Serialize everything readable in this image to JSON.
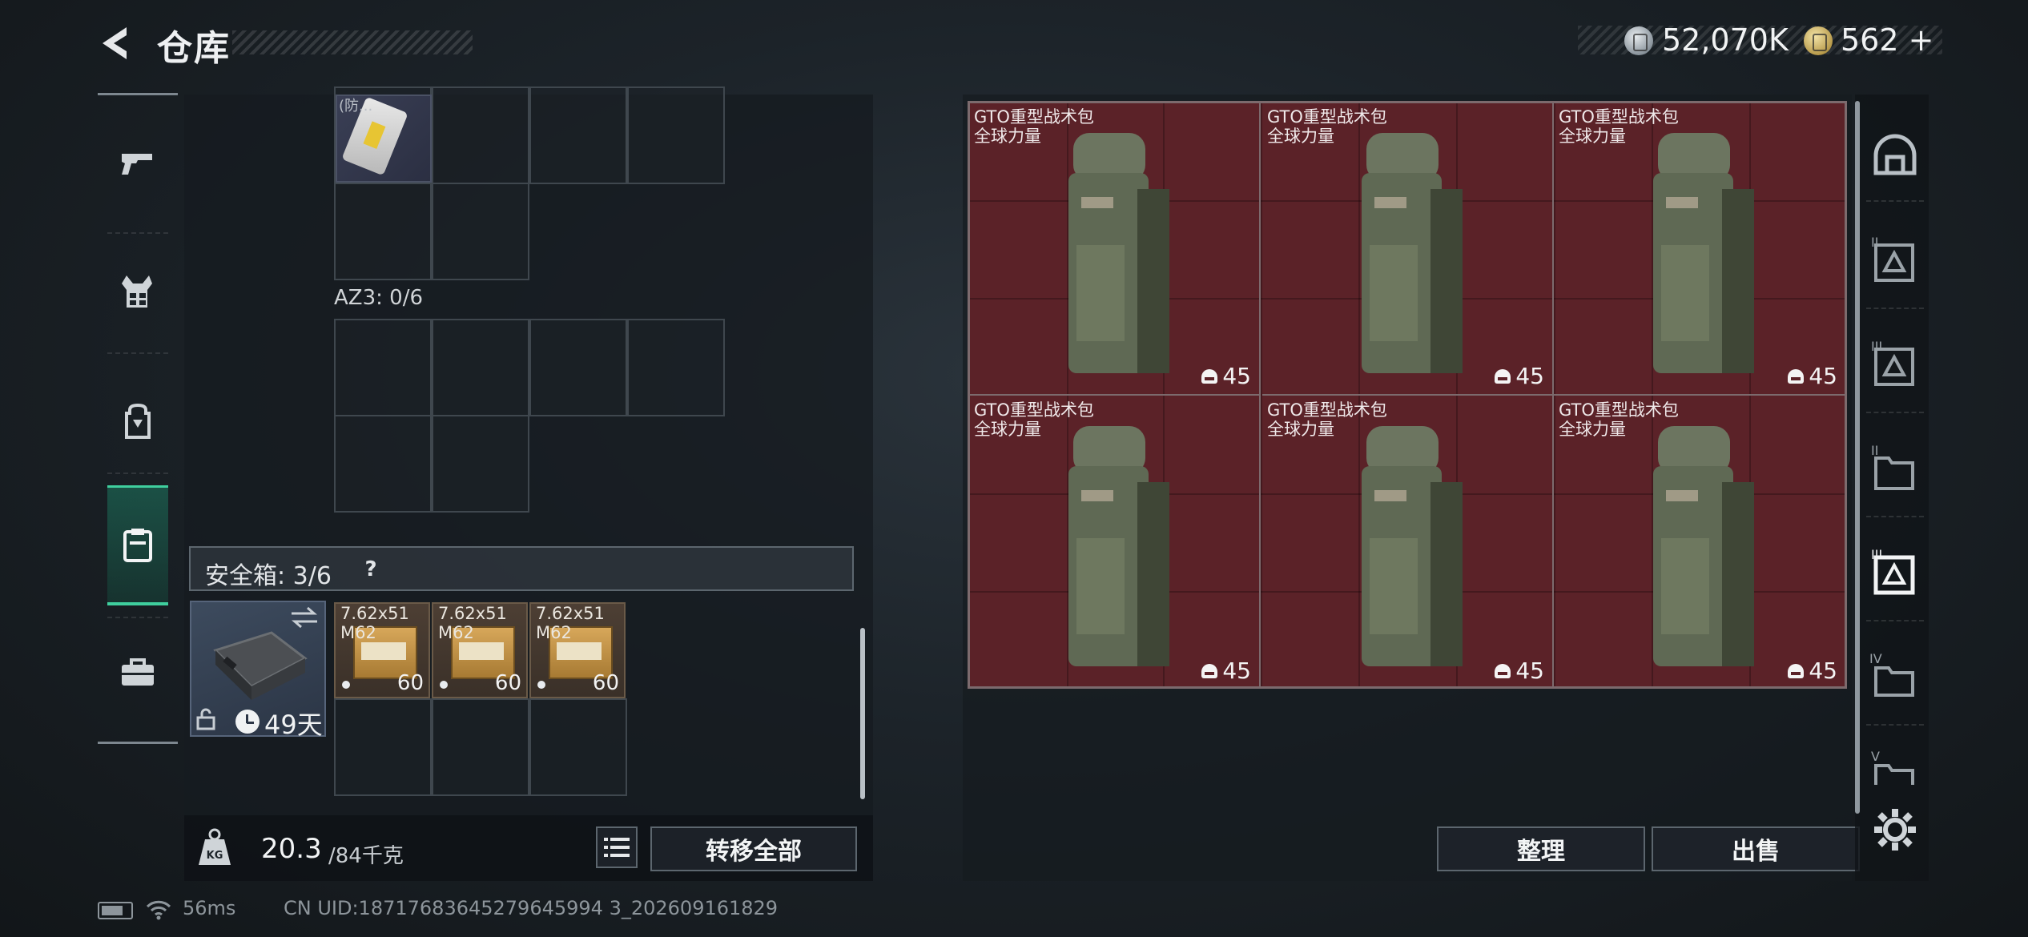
{
  "header": {
    "title": "仓库",
    "currency_silver": "52,070K",
    "currency_gold": "562",
    "currency_gold_suffix": "+"
  },
  "left_sidebar": {
    "items": [
      {
        "icon": "pistol-icon"
      },
      {
        "icon": "vest-icon"
      },
      {
        "icon": "backpack-icon"
      },
      {
        "icon": "container-icon",
        "active": true
      },
      {
        "icon": "briefcase-icon"
      }
    ]
  },
  "inventory": {
    "top_item_label": "(防...",
    "az3_label": "AZ3: 0/6",
    "safe_box_label": "安全箱: 3/6",
    "help_label": "?",
    "case_days": "49天",
    "ammo": [
      {
        "name_line1": "7.62x51",
        "name_line2": "M62",
        "count": "60"
      },
      {
        "name_line1": "7.62x51",
        "name_line2": "M62",
        "count": "60"
      },
      {
        "name_line1": "7.62x51",
        "name_line2": "M62",
        "count": "60"
      }
    ],
    "weight_value": "20.3",
    "weight_max": "/84千克",
    "transfer_all_label": "转移全部"
  },
  "stash": {
    "items": [
      {
        "name": "GTO重型战术包",
        "subtitle": "全球力量",
        "tag": "45"
      },
      {
        "name": "GTO重型战术包",
        "subtitle": "全球力量",
        "tag": "45"
      },
      {
        "name": "GTO重型战术包",
        "subtitle": "全球力量",
        "tag": "45"
      },
      {
        "name": "GTO重型战术包",
        "subtitle": "全球力量",
        "tag": "45"
      },
      {
        "name": "GTO重型战术包",
        "subtitle": "全球力量",
        "tag": "45"
      },
      {
        "name": "GTO重型战术包",
        "subtitle": "全球力量",
        "tag": "45"
      }
    ],
    "sort_label": "整理",
    "sell_label": "出售"
  },
  "right_sidebar": {
    "tabs": [
      {
        "icon": "home-stash-icon"
      },
      {
        "icon": "tier-ii-stash-icon",
        "label": "II"
      },
      {
        "icon": "tier-iii-stash-icon",
        "label": "III"
      },
      {
        "icon": "tier-ii-folder-icon",
        "label": "II"
      },
      {
        "icon": "tier-iii-active-icon",
        "label": "III"
      },
      {
        "icon": "tier-iv-icon",
        "label": "IV"
      },
      {
        "icon": "tier-v-icon",
        "label": "V"
      }
    ]
  },
  "footer": {
    "ping": "56ms",
    "uid": "CN UID:18717683645279645994 3_202609161829"
  },
  "colors": {
    "accent_green": "#3fcf9e",
    "stash_red": "#5b2228",
    "ammo_brown": "#4d3f34",
    "case_blue": "#3d4b5e"
  }
}
